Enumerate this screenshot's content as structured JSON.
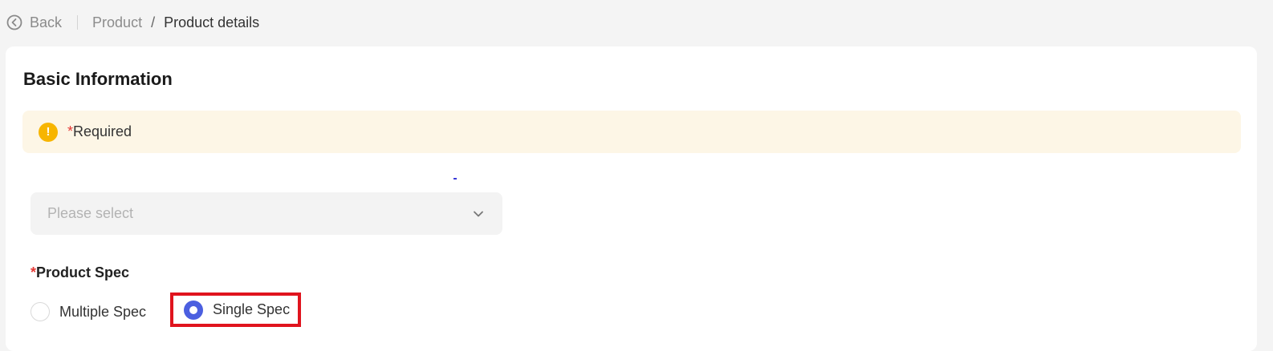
{
  "nav": {
    "back_label": "Back",
    "breadcrumb": {
      "parent": "Product",
      "separator": "/",
      "current": "Product details"
    }
  },
  "form": {
    "section_title": "Basic Information",
    "notice": {
      "star": "*",
      "text": "Required",
      "icon": "info-icon",
      "icon_glyph": "!"
    },
    "select": {
      "placeholder": "Please select"
    },
    "product_spec": {
      "star": "*",
      "label": "Product Spec",
      "options": [
        {
          "label": "Multiple Spec",
          "checked": false
        },
        {
          "label": "Single Spec",
          "checked": true
        }
      ],
      "highlighted_option": "Single Spec"
    }
  },
  "colors": {
    "accent": "#4b5fe0",
    "warning": "#f7b500",
    "required": "#e53935",
    "highlight_border": "#e0141e"
  }
}
